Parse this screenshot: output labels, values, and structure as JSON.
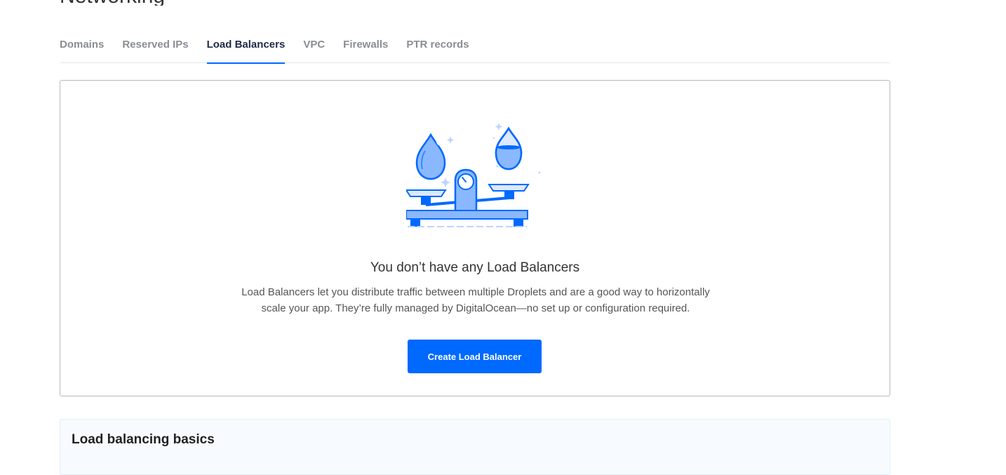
{
  "page": {
    "title_partial": "Networking"
  },
  "tabs": [
    {
      "label": "Domains",
      "active": false
    },
    {
      "label": "Reserved IPs",
      "active": false
    },
    {
      "label": "Load Balancers",
      "active": true
    },
    {
      "label": "VPC",
      "active": false
    },
    {
      "label": "Firewalls",
      "active": false
    },
    {
      "label": "PTR records",
      "active": false
    }
  ],
  "empty_state": {
    "illustration": "scale-with-droplets-icon",
    "title": "You don’t have any Load Balancers",
    "description_line1": "Load Balancers let you distribute traffic between multiple Droplets and are a good way to horizontally",
    "description_line2": "scale your app. They’re fully managed by DigitalOcean—no set up or configuration required.",
    "button_label": "Create Load Balancer"
  },
  "basics": {
    "title": "Load balancing basics"
  },
  "colors": {
    "accent": "#0069ff",
    "active_tab_text": "#1f2a44",
    "inactive_tab_text": "#8a8d93",
    "illustration_light": "#8ab8ff"
  }
}
